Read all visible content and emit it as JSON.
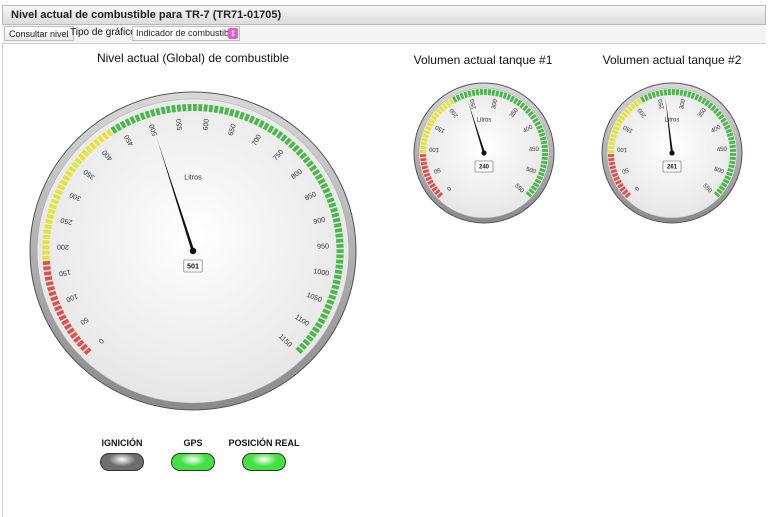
{
  "window": {
    "title": "Nivel actual de combustible para TR-7 (TR71-01705)"
  },
  "toolbar": {
    "consult_label": "Consultar nivel",
    "chart_type_label": "Tipo de gráfico",
    "chart_type_value": "Indicador de combustible"
  },
  "gauges": [
    {
      "id": "global",
      "title": "Nivel actual (Global) de combustible",
      "unit": "Litros",
      "value": 501,
      "value_label": "501",
      "min": 0,
      "max": 1150,
      "ticks": [
        "0",
        "50",
        "100",
        "150",
        "200",
        "250",
        "300",
        "350",
        "400",
        "450",
        "500",
        "550",
        "600",
        "650",
        "700",
        "750",
        "800",
        "850",
        "900",
        "950",
        "1000",
        "1050",
        "1100",
        "1150"
      ],
      "bands": [
        {
          "from": 0,
          "to": 180,
          "color": "#d9534f"
        },
        {
          "from": 180,
          "to": 430,
          "color": "#e3e33a"
        },
        {
          "from": 430,
          "to": 1150,
          "color": "#4cb84c"
        }
      ]
    },
    {
      "id": "tank1",
      "title": "Volumen actual tanque #1",
      "unit": "Litros",
      "value": 240,
      "value_label": "240",
      "min": 0,
      "max": 550,
      "ticks": [
        "0",
        "50",
        "100",
        "150",
        "200",
        "250",
        "300",
        "350",
        "400",
        "450",
        "500",
        "550"
      ],
      "bands": [
        {
          "from": 0,
          "to": 90,
          "color": "#d9534f"
        },
        {
          "from": 90,
          "to": 210,
          "color": "#e3e33a"
        },
        {
          "from": 210,
          "to": 550,
          "color": "#4cb84c"
        }
      ]
    },
    {
      "id": "tank2",
      "title": "Volumen actual tanque #2",
      "unit": "Litros",
      "value": 261,
      "value_label": "261",
      "min": 0,
      "max": 550,
      "ticks": [
        "0",
        "50",
        "100",
        "150",
        "200",
        "250",
        "300",
        "350",
        "400",
        "450",
        "500",
        "550"
      ],
      "bands": [
        {
          "from": 0,
          "to": 90,
          "color": "#d9534f"
        },
        {
          "from": 90,
          "to": 210,
          "color": "#e3e33a"
        },
        {
          "from": 210,
          "to": 550,
          "color": "#4cb84c"
        }
      ]
    }
  ],
  "indicators": [
    {
      "label": "IGNICIÓN",
      "state": "off",
      "color": "#6e6e6e"
    },
    {
      "label": "GPS",
      "state": "on",
      "color": "#44e044"
    },
    {
      "label": "POSICIÓN REAL",
      "state": "on",
      "color": "#44e044"
    }
  ]
}
